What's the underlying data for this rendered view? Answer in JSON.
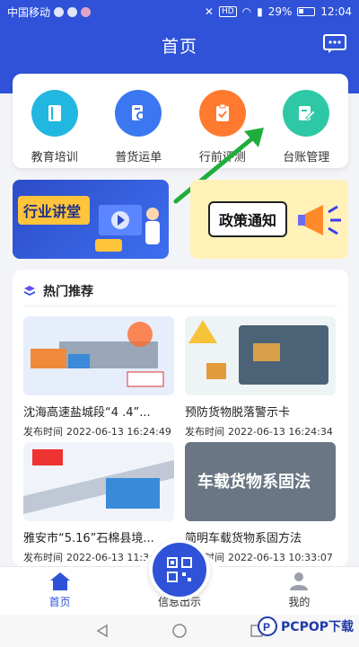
{
  "status_bar": {
    "carrier": "中国移动",
    "battery": "29%",
    "time": "12:04",
    "hd": "HD"
  },
  "header": {
    "title": "首页"
  },
  "quick_actions": [
    {
      "label": "教育培训",
      "icon": "book-icon",
      "color": "#21b7e0"
    },
    {
      "label": "普货运单",
      "icon": "document-search-icon",
      "color": "#3a77f0"
    },
    {
      "label": "行前评测",
      "icon": "clipboard-check-icon",
      "color": "#ff7a2e"
    },
    {
      "label": "台账管理",
      "icon": "edit-note-icon",
      "color": "#2fc8a6"
    }
  ],
  "banners": [
    {
      "title": "行业讲堂"
    },
    {
      "title": "政策通知"
    }
  ],
  "hot": {
    "title": "热门推荐",
    "items": [
      {
        "title": "沈海高速盐城段“4 .4”...",
        "time_label": "发布时间",
        "time": "2022-06-13 16:24:49"
      },
      {
        "title": "预防货物脱落警示卡",
        "time_label": "发布时间",
        "time": "2022-06-13 16:24:34"
      },
      {
        "title": "雅安市“5.16”石棉县境...",
        "time_label": "发布时间",
        "time": "2022-06-13 11:3"
      },
      {
        "title": "简明车载货物系固方法",
        "time_label": "发布时间",
        "time": "2022-06-13 10:33:07",
        "thumb_text": "车载货物系固法"
      }
    ]
  },
  "bottom_nav": {
    "home": "首页",
    "info": "信息出示",
    "mine": "我的"
  },
  "watermark": {
    "text": "PCPOP下载"
  },
  "colors": {
    "primary": "#2f52d8",
    "arrow": "#1fae3c"
  }
}
